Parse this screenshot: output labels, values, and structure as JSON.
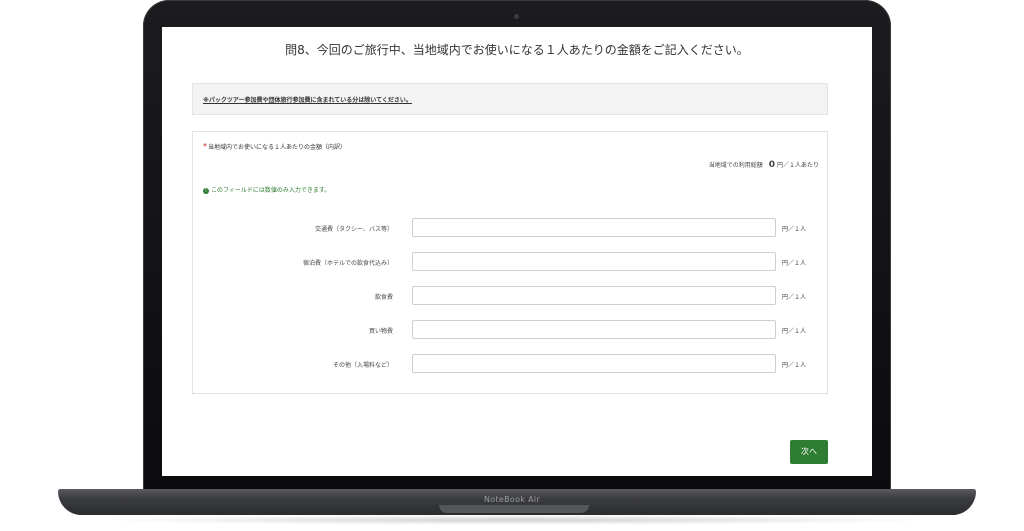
{
  "device": {
    "model_label": "NoteBook Air"
  },
  "form": {
    "question": "問8、今回のご旅行中、当地域内でお使いになる１人あたりの金額をご記入ください。",
    "notice": "※パックツアー参加費や団体旅行参加費に含まれている分は除いてください。",
    "required_mark": "*",
    "field_title": "当地域内でお使いになる１人あたりの金額（内訳）",
    "total_label": "当地域での利用総額",
    "total_value": "0",
    "total_unit": "円／１人あたり",
    "hint": "このフィールドには数値のみ入力できます。",
    "hint_icon": "!",
    "rows": [
      {
        "label": "交通費（タクシー、バス等）",
        "value": "",
        "unit": "円／１人"
      },
      {
        "label": "宿泊費（ホテルでの飲食代込み）",
        "value": "",
        "unit": "円／１人"
      },
      {
        "label": "飲食費",
        "value": "",
        "unit": "円／１人"
      },
      {
        "label": "買い物費",
        "value": "",
        "unit": "円／１人"
      },
      {
        "label": "その他（入場料など）",
        "value": "",
        "unit": "円／１人"
      }
    ],
    "next_label": "次へ",
    "accent_color": "#2e7d32"
  }
}
